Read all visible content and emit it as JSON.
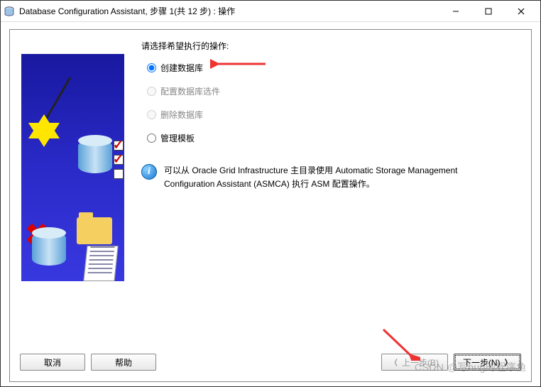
{
  "window": {
    "title": "Database Configuration Assistant, 步骤 1(共 12 步) : 操作"
  },
  "prompt": "请选择希望执行的操作:",
  "options": [
    {
      "label": "创建数据库",
      "selected": true,
      "enabled": true
    },
    {
      "label": "配置数据库选件",
      "selected": false,
      "enabled": false
    },
    {
      "label": "删除数据库",
      "selected": false,
      "enabled": false
    },
    {
      "label": "管理模板",
      "selected": false,
      "enabled": true
    }
  ],
  "info": {
    "text": "可以从 Oracle Grid Infrastructure 主目录使用 Automatic Storage Management Configuration Assistant (ASMCA) 执行 ASM 配置操作。"
  },
  "buttons": {
    "cancel": "取消",
    "help": "帮助",
    "back": "上一步(B)",
    "next": "下一步(N)"
  },
  "watermark": "CSDN @写bug的程序鱼"
}
